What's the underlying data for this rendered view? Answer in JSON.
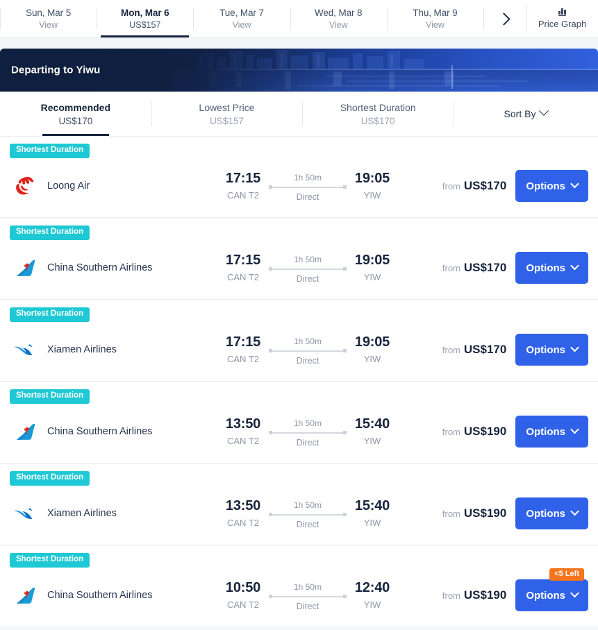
{
  "date_strip": {
    "tabs": [
      {
        "day": "Sun, Mar 5",
        "sub": "View",
        "active": false
      },
      {
        "day": "Mon, Mar 6",
        "sub": "US$157",
        "active": true
      },
      {
        "day": "Tue, Mar 7",
        "sub": "View",
        "active": false
      },
      {
        "day": "Wed, Mar 8",
        "sub": "View",
        "active": false
      },
      {
        "day": "Thu, Mar 9",
        "sub": "View",
        "active": false
      }
    ],
    "next_icon": "chevron-right-icon",
    "price_graph_label": "Price Graph",
    "price_graph_icon": "bar-chart-icon"
  },
  "banner": {
    "title": "Departing to Yiwu"
  },
  "sortbar": {
    "tabs": [
      {
        "label": "Recommended",
        "price": "US$170",
        "active": true
      },
      {
        "label": "Lowest Price",
        "price": "US$157",
        "active": false
      },
      {
        "label": "Shortest Duration",
        "price": "US$170",
        "active": false
      }
    ],
    "sort_by_label": "Sort By",
    "sort_by_icon": "chevron-down-icon"
  },
  "flights": [
    {
      "badge": "Shortest Duration",
      "airline": "Loong Air",
      "logo": "loong-air-logo",
      "depart_time": "17:15",
      "depart_code": "CAN T2",
      "duration": "1h 50m",
      "stops": "Direct",
      "arrive_time": "19:05",
      "arrive_code": "YIW",
      "price_from": "from",
      "price": "US$170",
      "options_label": "Options",
      "seats_badge": null
    },
    {
      "badge": "Shortest Duration",
      "airline": "China Southern Airlines",
      "logo": "china-southern-logo",
      "depart_time": "17:15",
      "depart_code": "CAN T2",
      "duration": "1h 50m",
      "stops": "Direct",
      "arrive_time": "19:05",
      "arrive_code": "YIW",
      "price_from": "from",
      "price": "US$170",
      "options_label": "Options",
      "seats_badge": null
    },
    {
      "badge": "Shortest Duration",
      "airline": "Xiamen Airlines",
      "logo": "xiamen-airlines-logo",
      "depart_time": "17:15",
      "depart_code": "CAN T2",
      "duration": "1h 50m",
      "stops": "Direct",
      "arrive_time": "19:05",
      "arrive_code": "YIW",
      "price_from": "from",
      "price": "US$170",
      "options_label": "Options",
      "seats_badge": null
    },
    {
      "badge": "Shortest Duration",
      "airline": "China Southern Airlines",
      "logo": "china-southern-logo",
      "depart_time": "13:50",
      "depart_code": "CAN T2",
      "duration": "1h 50m",
      "stops": "Direct",
      "arrive_time": "15:40",
      "arrive_code": "YIW",
      "price_from": "from",
      "price": "US$190",
      "options_label": "Options",
      "seats_badge": null
    },
    {
      "badge": "Shortest Duration",
      "airline": "Xiamen Airlines",
      "logo": "xiamen-airlines-logo",
      "depart_time": "13:50",
      "depart_code": "CAN T2",
      "duration": "1h 50m",
      "stops": "Direct",
      "arrive_time": "15:40",
      "arrive_code": "YIW",
      "price_from": "from",
      "price": "US$190",
      "options_label": "Options",
      "seats_badge": null
    },
    {
      "badge": "Shortest Duration",
      "airline": "China Southern Airlines",
      "logo": "china-southern-logo",
      "depart_time": "10:50",
      "depart_code": "CAN T2",
      "duration": "1h 50m",
      "stops": "Direct",
      "arrive_time": "12:40",
      "arrive_code": "YIW",
      "price_from": "from",
      "price": "US$190",
      "options_label": "Options",
      "seats_badge": "<5 Left"
    }
  ],
  "colors": {
    "accent_blue": "#2f62e8",
    "badge_teal": "#1ec8d4",
    "badge_orange": "#f5751f",
    "navy": "#17243d"
  }
}
